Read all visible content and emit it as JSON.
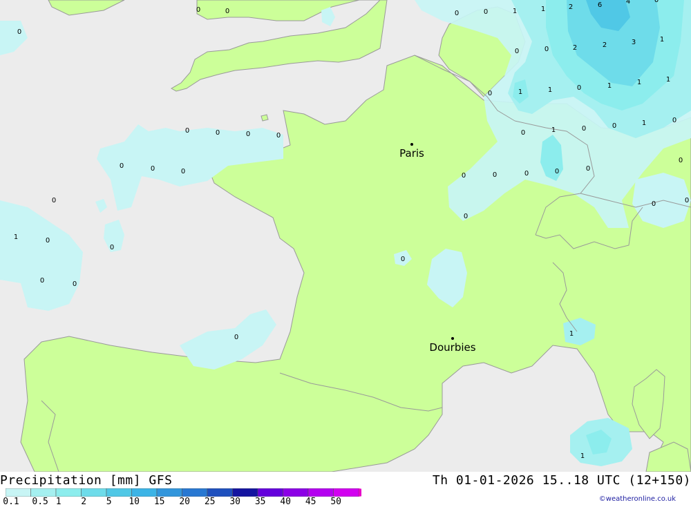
{
  "title": "Precipitation [mm] GFS",
  "datetime": "Th 01-01-2026 15..18 UTC (12+150)",
  "credit": "©weatheronline.co.uk",
  "colors": {
    "sea": "#ececec",
    "land": "#ccff99",
    "border": "#999999"
  },
  "legend": {
    "labels": [
      "0.1",
      "0.5",
      "1",
      "2",
      "5",
      "10",
      "15",
      "20",
      "25",
      "30",
      "35",
      "40",
      "45",
      "50"
    ],
    "colors": [
      "#c8f5f5",
      "#a5f0f0",
      "#8ceded",
      "#6edcea",
      "#50c8e6",
      "#3cb4e6",
      "#3296dc",
      "#2878d2",
      "#1e50be",
      "#1414a0",
      "#6400dc",
      "#8c00e6",
      "#b400f0",
      "#d200f0",
      "#e600c8"
    ]
  },
  "cities": [
    {
      "name": "Paris"
    },
    {
      "name": "Dourbies"
    }
  ],
  "labels": [
    "0",
    "0",
    "0",
    "0",
    "0",
    "1",
    "1",
    "2",
    "6",
    "4",
    "0",
    "0",
    "2",
    "2",
    "3",
    "1",
    "0",
    "1",
    "1",
    "0",
    "1",
    "1",
    "1",
    "0",
    "1",
    "0",
    "0",
    "1",
    "0",
    "0",
    "0",
    "0",
    "0",
    "0",
    "0",
    "0",
    "0",
    "0",
    "0",
    "0",
    "0",
    "0",
    "1",
    "0",
    "0",
    "0",
    "0",
    "0",
    "0",
    "0",
    "0",
    "0",
    "0",
    "1",
    "1",
    "0"
  ]
}
